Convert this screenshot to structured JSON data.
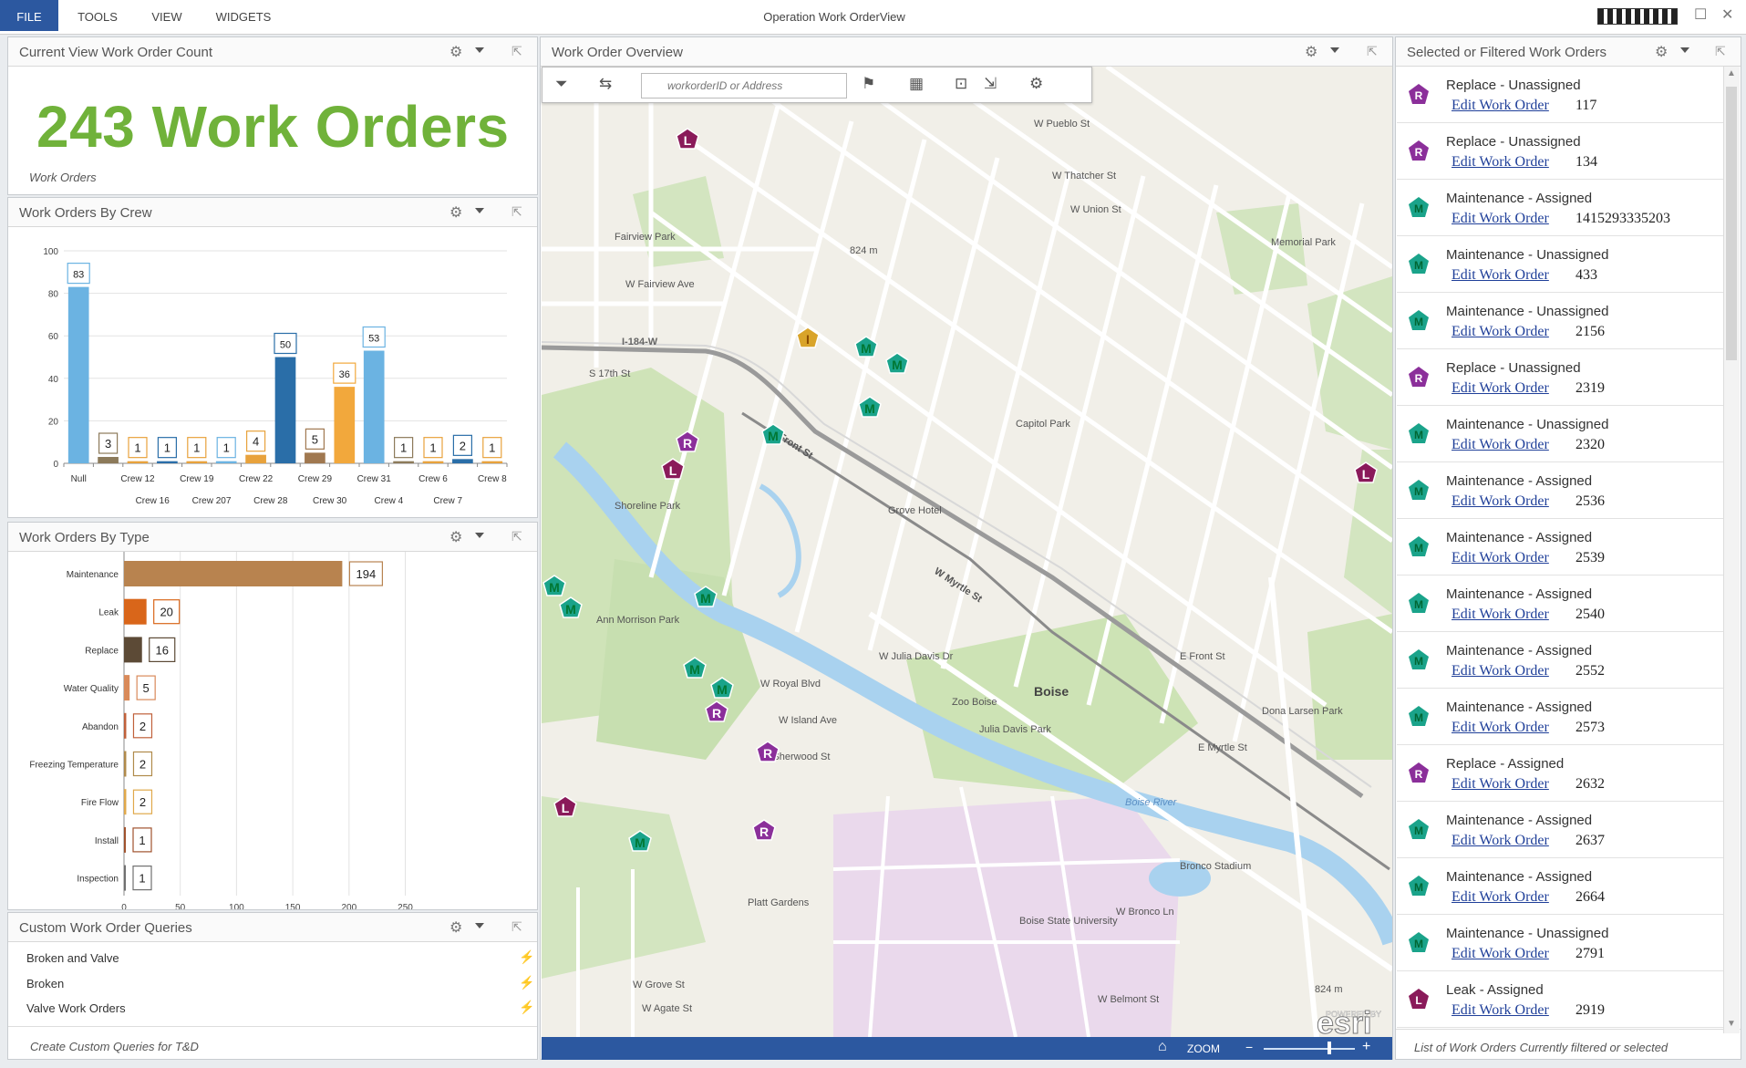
{
  "menu": {
    "file": "FILE",
    "tools": "TOOLS",
    "view": "VIEW",
    "widgets": "WIDGETS"
  },
  "app_title": "Operation Work OrderView",
  "count_panel": {
    "title": "Current View Work Order Count",
    "count_text": "243 Work Orders",
    "caption": "Work Orders"
  },
  "crew_panel": {
    "title": "Work Orders By Crew"
  },
  "type_panel": {
    "title": "Work Orders By Type"
  },
  "queries_panel": {
    "title": "Custom Work Order Queries",
    "items": [
      "Broken and Valve",
      "Broken",
      "Valve Work Orders"
    ],
    "footer": "Create Custom Queries for T&D"
  },
  "map_panel": {
    "title": "Work Order Overview",
    "search_placeholder": "workorderID or Address",
    "zoom_label": "ZOOM",
    "labels": {
      "boise": "Boise",
      "boise_river": "Boise River",
      "ann_morrison": "Ann Morrison Park",
      "shoreline": "Shoreline Park",
      "julia_davis": "Julia Davis Park",
      "zoo": "Zoo Boise",
      "bsu": "Boise State University",
      "fairview_park": "Fairview Park",
      "memorial_park": "Memorial Park",
      "bronco": "Bronco Stadium",
      "dona_larsen": "Dona Larsen Park",
      "capitol_park": "Capitol Park",
      "grove_hotel": "Grove Hotel",
      "plat_gardens": "Platt Gardens",
      "i184": "I-184-W",
      "w_front": "W Front St",
      "w_myrtle": "W Myrtle St",
      "w_fairview": "W Fairview Ave",
      "s17th": "S 17th St",
      "w_pueblo": "W Pueblo St",
      "w_thatcher": "W Thatcher St",
      "w_union": "W Union St",
      "w_royal": "W Royal Blvd",
      "w_island": "W Island Ave",
      "w_sherwood": "W Sherwood St",
      "w_grove": "W Grove St",
      "w_agate": "W Agate St",
      "w_belmont": "W Belmont St",
      "w_bronco": "W Bronco Ln",
      "w_julia_davis": "W Julia Davis Dr",
      "e_front": "E Front St",
      "e_myrtle": "E Myrtle St",
      "elev_824": "824 m",
      "esri": "esri",
      "powered_by": "POWERED BY"
    }
  },
  "list_panel": {
    "title": "Selected or Filtered Work Orders",
    "footer": "List of Work Orders Currently filtered or selected",
    "link_text": "Edit Work Order",
    "items": [
      {
        "title": "Replace - Unassigned",
        "id": "117",
        "badge": "R"
      },
      {
        "title": "Replace - Unassigned",
        "id": "134",
        "badge": "R"
      },
      {
        "title": "Maintenance - Assigned",
        "id": "1415293335203",
        "badge": "M"
      },
      {
        "title": "Maintenance - Unassigned",
        "id": "433",
        "badge": "M"
      },
      {
        "title": "Maintenance - Unassigned",
        "id": "2156",
        "badge": "M"
      },
      {
        "title": "Replace - Unassigned",
        "id": "2319",
        "badge": "R"
      },
      {
        "title": "Maintenance - Unassigned",
        "id": "2320",
        "badge": "M"
      },
      {
        "title": "Maintenance - Assigned",
        "id": "2536",
        "badge": "M"
      },
      {
        "title": "Maintenance - Assigned",
        "id": "2539",
        "badge": "M"
      },
      {
        "title": "Maintenance - Assigned",
        "id": "2540",
        "badge": "M"
      },
      {
        "title": "Maintenance - Assigned",
        "id": "2552",
        "badge": "M"
      },
      {
        "title": "Maintenance - Assigned",
        "id": "2573",
        "badge": "M"
      },
      {
        "title": "Replace - Assigned",
        "id": "2632",
        "badge": "R"
      },
      {
        "title": "Maintenance - Assigned",
        "id": "2637",
        "badge": "M"
      },
      {
        "title": "Maintenance - Assigned",
        "id": "2664",
        "badge": "M"
      },
      {
        "title": "Maintenance - Unassigned",
        "id": "2791",
        "badge": "M"
      },
      {
        "title": "Leak - Assigned",
        "id": "2919",
        "badge": "L"
      }
    ]
  },
  "colors": {
    "accent": "#2c58a0",
    "count_green": "#70b23a",
    "maintenance": "#1aa38a",
    "replace": "#8b2f9a",
    "leak": "#8a1a5a",
    "inspection": "#d9a42a"
  },
  "chart_data": [
    {
      "type": "bar",
      "categories": [
        "Null",
        "Crew 16",
        "Crew 12",
        "Crew 19",
        "Crew 207",
        "Crew 22",
        "Crew 28",
        "Crew 29",
        "Crew 30",
        "Crew 31",
        "Crew 4",
        "Crew 6",
        "Crew 7",
        "Crew 8"
      ],
      "values": [
        83,
        3,
        1,
        1,
        1,
        1,
        4,
        50,
        5,
        36,
        53,
        1,
        1,
        2,
        1
      ],
      "bar_values": [
        83,
        3,
        1,
        1,
        1,
        1,
        4,
        50,
        5,
        36,
        53,
        1,
        1,
        2,
        1
      ],
      "bar_colors": [
        "#6bb3e2",
        "#8c7a5a",
        "#e8a23c",
        "#2a6ea8",
        "#e8a23c",
        "#6bb3e2",
        "#e8a23c",
        "#2a6ea8",
        "#a07850",
        "#f2a83c",
        "#6bb3e2",
        "#8c7a5a",
        "#e8a23c",
        "#2a6ea8",
        "#e8a23c"
      ],
      "x_labels_row1": [
        "Null",
        "Crew 12",
        "Crew 19",
        "Crew 22",
        "Crew 29",
        "Crew 31",
        "Crew 6",
        "Crew 8"
      ],
      "x_labels_row2": [
        "Crew 16",
        "Crew 207",
        "Crew 28",
        "Crew 30",
        "Crew 4",
        "Crew 7"
      ],
      "yticks": [
        0,
        20,
        40,
        60,
        80,
        100
      ],
      "ylim": [
        0,
        100
      ]
    },
    {
      "type": "bar",
      "orientation": "horizontal",
      "categories": [
        "Maintenance",
        "Leak",
        "Replace",
        "Water Quality",
        "Abandon",
        "Freezing Temperature",
        "Fire Flow",
        "Install",
        "Inspection"
      ],
      "values": [
        194,
        20,
        16,
        5,
        2,
        2,
        2,
        1,
        1
      ],
      "bar_colors": [
        "#b8834f",
        "#d9661a",
        "#5c4a36",
        "#d98a5a",
        "#c0603a",
        "#b08a4a",
        "#e0a84a",
        "#a0522d",
        "#707070"
      ],
      "xticks": [
        0,
        50,
        100,
        150,
        200,
        250
      ],
      "xlim": [
        0,
        250
      ]
    }
  ]
}
